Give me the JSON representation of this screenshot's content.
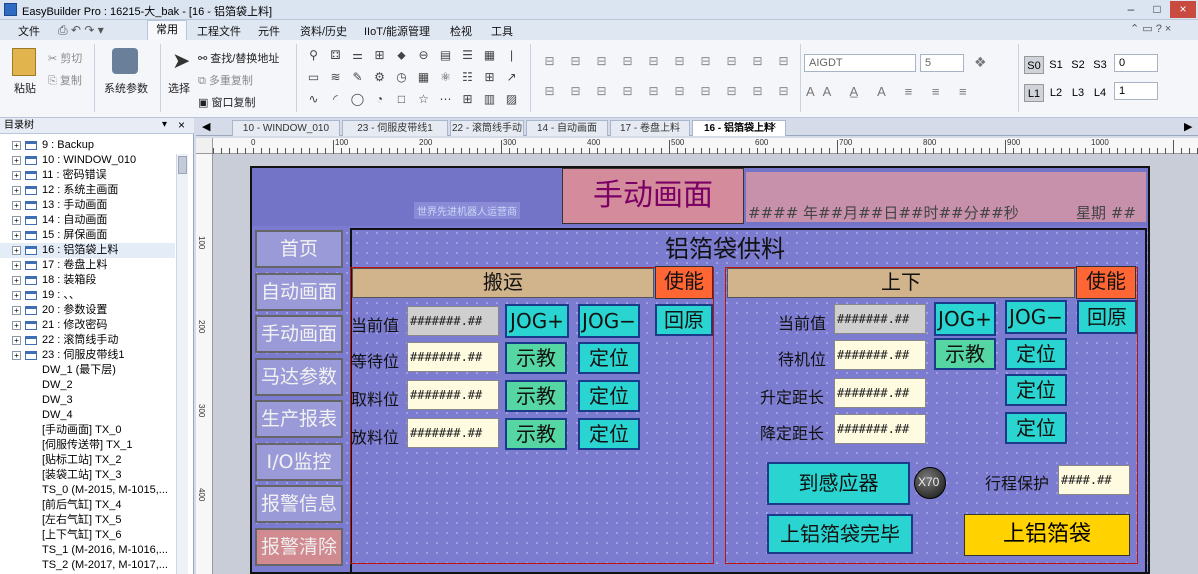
{
  "app": {
    "title": "EasyBuilder Pro : 16215-大_bak - [16 - 铝箔袋上料]"
  },
  "menu": {
    "file": "文件",
    "common": "常用",
    "project": "工程文件",
    "element": "元件",
    "data": "资料/历史",
    "iiot": "IIoT/能源管理",
    "check": "检视",
    "tools": "工具"
  },
  "ribbon": {
    "paste": "粘贴",
    "cut": "剪切",
    "copy": "复制",
    "sys_params": "系统参数",
    "select": "选择",
    "find_replace": "查找/替换地址",
    "multi_copy": "多重复制",
    "window_copy": "窗口复制",
    "font": "AIGDT",
    "font_size": "5",
    "states": [
      "S0",
      "S1",
      "S2",
      "S3"
    ],
    "state_value": "0",
    "levels": [
      "L1",
      "L2",
      "L3",
      "L4"
    ],
    "level_value": "1"
  },
  "tree": {
    "header": "目录树",
    "items": [
      "9 : Backup",
      "10 : WINDOW_010",
      "11 : 密码错误",
      "12 : 系统主画面",
      "13 : 手动画面",
      "14 : 自动画面",
      "15 : 屏保画面",
      "16 : 铝箔袋上料",
      "17 : 卷盘上料",
      "18 : 装箱段",
      "19 : 、、",
      "20 : 参数设置",
      "21 : 修改密码",
      "22 : 滚筒线手动",
      "23 : 伺服皮带线1"
    ],
    "subitems": [
      "DW_1 (最下层)",
      "DW_2",
      "DW_3",
      "DW_4",
      "[手动画面] TX_0",
      "[伺服传送带] TX_1",
      "[贴标工站] TX_2",
      "[装袋工站] TX_3",
      "TS_0 (M-2015, M-1015,...",
      "[前后气缸] TX_4",
      "[左右气缸] TX_5",
      "[上下气缸] TX_6",
      "TS_1 (M-2016, M-1016,...",
      "TS_2 (M-2017, M-1017,..."
    ]
  },
  "tabs": [
    "10 - WINDOW_010",
    "23 - 伺服皮带线1",
    "22 - 滚筒线手动",
    "14 - 自动画面",
    "17 - 卷盘上料",
    "16 - 铝箔袋上料"
  ],
  "ruler": [
    "0",
    "100",
    "200",
    "300",
    "400",
    "500",
    "600",
    "700",
    "800",
    "900",
    "1000"
  ],
  "ruler_v": [
    "100",
    "200",
    "300",
    "400"
  ],
  "hmi": {
    "screen_title": "手动画面",
    "company": "世界先进机器人运营商",
    "datetime": "#### 年##月##日##时##分##秒",
    "weekday": "星期 ##",
    "nav": [
      "首页",
      "自动画面",
      "手动画面",
      "马达参数",
      "生产报表",
      "I/O监控",
      "报警信息",
      "报警清除"
    ],
    "panel_title": "铝箔袋供料",
    "left": {
      "title": "搬运",
      "enable": "使能",
      "rows": [
        "当前值",
        "等待位",
        "取料位",
        "放料位"
      ],
      "value": "#######.##",
      "jog_plus": "JOG+",
      "jog_minus": "JOG−",
      "home": "回原",
      "teach": "示教",
      "locate": "定位"
    },
    "right": {
      "title": "上下",
      "enable": "使能",
      "rows": [
        "当前值",
        "待机位",
        "升定距长",
        "降定距长"
      ],
      "value": "#######.##",
      "jog_plus": "JOG+",
      "jog_minus": "JOG−",
      "home": "回原",
      "teach": "示教",
      "locate": "定位",
      "to_sensor": "到感应器",
      "sensor_tag": "X70",
      "travel_protect": "行程保护",
      "travel_value": "####.##",
      "load_done": "上铝箔袋完毕",
      "load": "上铝箔袋"
    }
  }
}
